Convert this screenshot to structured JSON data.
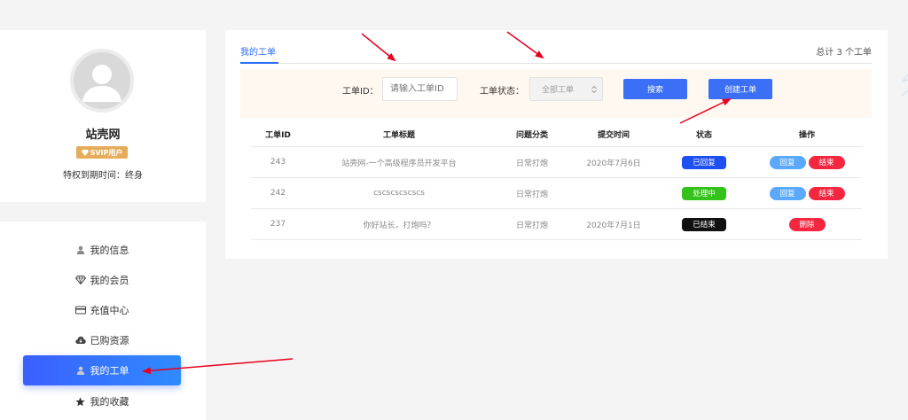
{
  "profile": {
    "username": "站壳网",
    "badge": "SVIP用户",
    "expire": "特权到期时间：终身"
  },
  "menu": {
    "items": [
      {
        "label": "我的信息",
        "icon": "user-icon"
      },
      {
        "label": "我的会员",
        "icon": "diamond-icon"
      },
      {
        "label": "充值中心",
        "icon": "card-icon"
      },
      {
        "label": "已购资源",
        "icon": "cloud-download-icon"
      },
      {
        "label": "我的工单",
        "icon": "user-icon",
        "active": true
      },
      {
        "label": "我的收藏",
        "icon": "star-icon"
      }
    ]
  },
  "main": {
    "tab_label": "我的工单",
    "total_text": "总计 3 个工单",
    "search": {
      "id_label": "工单ID：",
      "id_placeholder": "请输入工单ID",
      "status_label": "工单状态：",
      "status_selected": "全部工单",
      "search_button": "搜索",
      "create_button": "创建工单"
    },
    "table": {
      "headers": [
        "工单ID",
        "工单标题",
        "问题分类",
        "提交时间",
        "状态",
        "操作"
      ],
      "rows": [
        {
          "id": "243",
          "title": "站壳网-一个高级程序员开发平台",
          "category": "日常打炮",
          "time": "2020年7月6日",
          "status": "已回复",
          "actions": [
            "回复",
            "结束"
          ]
        },
        {
          "id": "242",
          "title": "cscscscscscs",
          "category": "日常打炮",
          "time": "",
          "status": "处理中",
          "actions": [
            "回复",
            "结束"
          ]
        },
        {
          "id": "237",
          "title": "你好站长，打炮吗？",
          "category": "日常打炮",
          "time": "2020年7月1日",
          "status": "已结束",
          "actions": [
            "删除"
          ]
        }
      ]
    }
  },
  "colors": {
    "primary": "#3b6ff6",
    "active_menu": "#3a60ff",
    "danger": "#f5263f",
    "success": "#33c21a",
    "vip": "#e5ad5a",
    "arrow": "#e8001c"
  }
}
